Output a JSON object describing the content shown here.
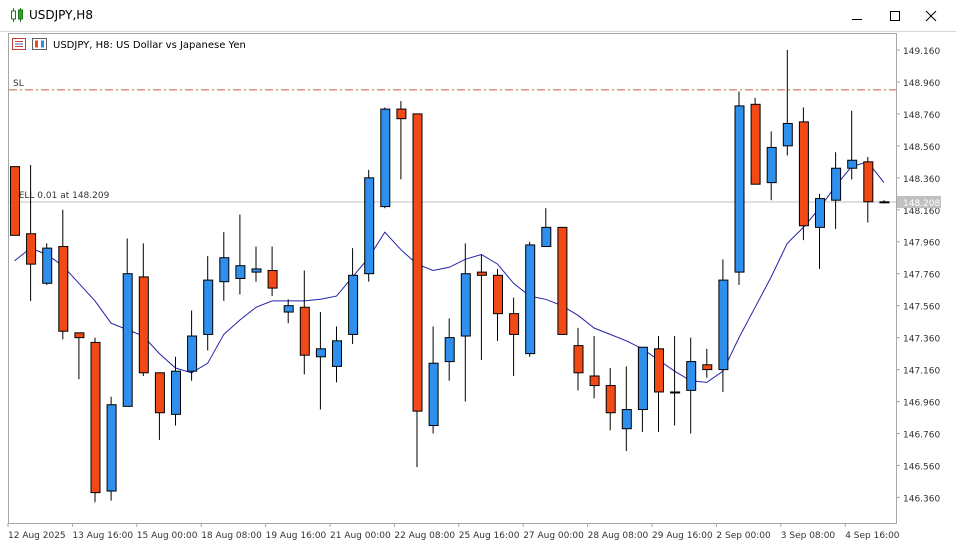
{
  "window": {
    "title": "USDJPY,H8"
  },
  "chart_header": {
    "symbol_text": "USDJPY, H8:  US Dollar vs Japanese Yen"
  },
  "sl_label": "SL",
  "position_label": "SELL 0.01 at 148.209",
  "price_badge": "148.208",
  "colors": {
    "bull": "#2e8fed",
    "bear": "#f24a17",
    "ma": "#2222aa",
    "sl_line": "#d0633a",
    "position_line": "#c0c0c0",
    "badge_bg": "#c0c0c0"
  },
  "chart_data": {
    "type": "candlestick",
    "symbol": "USDJPY",
    "timeframe": "H8",
    "ylim": [
      146.2,
      149.26
    ],
    "y_ticks": [
      "149.160",
      "148.960",
      "148.760",
      "148.560",
      "148.360",
      "148.160",
      "147.960",
      "147.760",
      "147.560",
      "147.360",
      "147.160",
      "146.960",
      "146.760",
      "146.560",
      "146.360"
    ],
    "x_ticks": [
      {
        "label": "12 Aug 2025",
        "index": 0
      },
      {
        "label": "13 Aug 16:00",
        "index": 4
      },
      {
        "label": "15 Aug 00:00",
        "index": 8
      },
      {
        "label": "18 Aug 08:00",
        "index": 12
      },
      {
        "label": "19 Aug 16:00",
        "index": 16
      },
      {
        "label": "21 Aug 00:00",
        "index": 20
      },
      {
        "label": "22 Aug 08:00",
        "index": 24
      },
      {
        "label": "25 Aug 16:00",
        "index": 28
      },
      {
        "label": "27 Aug 00:00",
        "index": 32
      },
      {
        "label": "28 Aug 08:00",
        "index": 36
      },
      {
        "label": "29 Aug 16:00",
        "index": 40
      },
      {
        "label": "2 Sep 00:00",
        "index": 44
      },
      {
        "label": "3 Sep 08:00",
        "index": 48
      },
      {
        "label": "4 Sep 16:00",
        "index": 52
      }
    ],
    "sl_price": 148.91,
    "position_price": 148.209,
    "candles": [
      {
        "o": 148.43,
        "h": 148.43,
        "l": 148.0,
        "c": 148.0
      },
      {
        "o": 148.01,
        "h": 148.44,
        "l": 147.59,
        "c": 147.82
      },
      {
        "o": 147.7,
        "h": 147.95,
        "l": 147.69,
        "c": 147.92
      },
      {
        "o": 147.93,
        "h": 148.16,
        "l": 147.35,
        "c": 147.4
      },
      {
        "o": 147.39,
        "h": 147.39,
        "l": 147.1,
        "c": 147.36
      },
      {
        "o": 147.33,
        "h": 147.36,
        "l": 146.33,
        "c": 146.39
      },
      {
        "o": 146.4,
        "h": 146.99,
        "l": 146.34,
        "c": 146.94
      },
      {
        "o": 146.93,
        "h": 147.98,
        "l": 146.93,
        "c": 147.76
      },
      {
        "o": 147.74,
        "h": 147.95,
        "l": 147.12,
        "c": 147.14
      },
      {
        "o": 147.14,
        "h": 147.14,
        "l": 146.72,
        "c": 146.89
      },
      {
        "o": 146.88,
        "h": 147.24,
        "l": 146.81,
        "c": 147.15
      },
      {
        "o": 147.15,
        "h": 147.53,
        "l": 147.09,
        "c": 147.37
      },
      {
        "o": 147.38,
        "h": 147.87,
        "l": 147.28,
        "c": 147.72
      },
      {
        "o": 147.71,
        "h": 148.02,
        "l": 147.59,
        "c": 147.86
      },
      {
        "o": 147.73,
        "h": 148.13,
        "l": 147.63,
        "c": 147.81
      },
      {
        "o": 147.77,
        "h": 147.93,
        "l": 147.71,
        "c": 147.79
      },
      {
        "o": 147.78,
        "h": 147.93,
        "l": 147.62,
        "c": 147.67
      },
      {
        "o": 147.52,
        "h": 147.6,
        "l": 147.45,
        "c": 147.56
      },
      {
        "o": 147.55,
        "h": 147.78,
        "l": 147.13,
        "c": 147.25
      },
      {
        "o": 147.24,
        "h": 147.52,
        "l": 146.91,
        "c": 147.29
      },
      {
        "o": 147.18,
        "h": 147.43,
        "l": 147.08,
        "c": 147.34
      },
      {
        "o": 147.38,
        "h": 147.92,
        "l": 147.32,
        "c": 147.75
      },
      {
        "o": 147.76,
        "h": 148.41,
        "l": 147.71,
        "c": 148.36
      },
      {
        "o": 148.18,
        "h": 148.8,
        "l": 148.17,
        "c": 148.79
      },
      {
        "o": 148.79,
        "h": 148.84,
        "l": 148.35,
        "c": 148.73
      },
      {
        "o": 148.76,
        "h": 148.76,
        "l": 146.55,
        "c": 146.9
      },
      {
        "o": 146.81,
        "h": 147.43,
        "l": 146.76,
        "c": 147.2
      },
      {
        "o": 147.21,
        "h": 147.48,
        "l": 147.09,
        "c": 147.36
      },
      {
        "o": 147.37,
        "h": 147.95,
        "l": 146.96,
        "c": 147.76
      },
      {
        "o": 147.77,
        "h": 147.88,
        "l": 147.22,
        "c": 147.75
      },
      {
        "o": 147.75,
        "h": 147.79,
        "l": 147.34,
        "c": 147.51
      },
      {
        "o": 147.51,
        "h": 147.61,
        "l": 147.12,
        "c": 147.38
      },
      {
        "o": 147.26,
        "h": 147.96,
        "l": 147.24,
        "c": 147.94
      },
      {
        "o": 147.93,
        "h": 148.17,
        "l": 147.97,
        "c": 148.05
      },
      {
        "o": 148.05,
        "h": 148.05,
        "l": 147.4,
        "c": 147.38
      },
      {
        "o": 147.31,
        "h": 147.42,
        "l": 147.03,
        "c": 147.14
      },
      {
        "o": 147.12,
        "h": 147.37,
        "l": 146.98,
        "c": 147.06
      },
      {
        "o": 147.06,
        "h": 147.17,
        "l": 146.78,
        "c": 146.89
      },
      {
        "o": 146.79,
        "h": 147.18,
        "l": 146.65,
        "c": 146.91
      },
      {
        "o": 146.91,
        "h": 147.28,
        "l": 146.77,
        "c": 147.3
      },
      {
        "o": 147.29,
        "h": 147.37,
        "l": 146.77,
        "c": 147.02
      },
      {
        "o": 147.02,
        "h": 147.37,
        "l": 146.81,
        "c": 147.02
      },
      {
        "o": 147.03,
        "h": 147.36,
        "l": 146.76,
        "c": 147.21
      },
      {
        "o": 147.19,
        "h": 147.29,
        "l": 147.11,
        "c": 147.16
      },
      {
        "o": 147.16,
        "h": 147.85,
        "l": 147.02,
        "c": 147.72
      },
      {
        "o": 147.77,
        "h": 148.9,
        "l": 147.69,
        "c": 148.81
      },
      {
        "o": 148.82,
        "h": 148.86,
        "l": 148.32,
        "c": 148.32
      },
      {
        "o": 148.33,
        "h": 148.65,
        "l": 148.22,
        "c": 148.55
      },
      {
        "o": 148.56,
        "h": 149.16,
        "l": 148.5,
        "c": 148.7
      },
      {
        "o": 148.71,
        "h": 148.8,
        "l": 147.97,
        "c": 148.06
      },
      {
        "o": 148.05,
        "h": 148.26,
        "l": 147.79,
        "c": 148.23
      },
      {
        "o": 148.22,
        "h": 148.52,
        "l": 148.04,
        "c": 148.42
      },
      {
        "o": 148.42,
        "h": 148.78,
        "l": 148.35,
        "c": 148.47
      },
      {
        "o": 148.46,
        "h": 148.49,
        "l": 148.08,
        "c": 148.21
      },
      {
        "o": 148.21,
        "h": 148.22,
        "l": 148.2,
        "c": 148.21
      }
    ],
    "ma": [
      147.84,
      147.92,
      147.88,
      147.81,
      147.7,
      147.59,
      147.45,
      147.41,
      147.37,
      147.26,
      147.17,
      147.14,
      147.2,
      147.38,
      147.47,
      147.55,
      147.59,
      147.59,
      147.59,
      147.6,
      147.62,
      147.74,
      147.86,
      148.02,
      147.91,
      147.82,
      147.78,
      147.8,
      147.85,
      147.88,
      147.82,
      147.7,
      147.62,
      147.6,
      147.56,
      147.5,
      147.42,
      147.38,
      147.34,
      147.29,
      147.22,
      147.15,
      147.09,
      147.08,
      147.15,
      147.36,
      147.55,
      147.74,
      147.95,
      148.05,
      148.17,
      148.31,
      148.43,
      148.46,
      148.33
    ]
  }
}
